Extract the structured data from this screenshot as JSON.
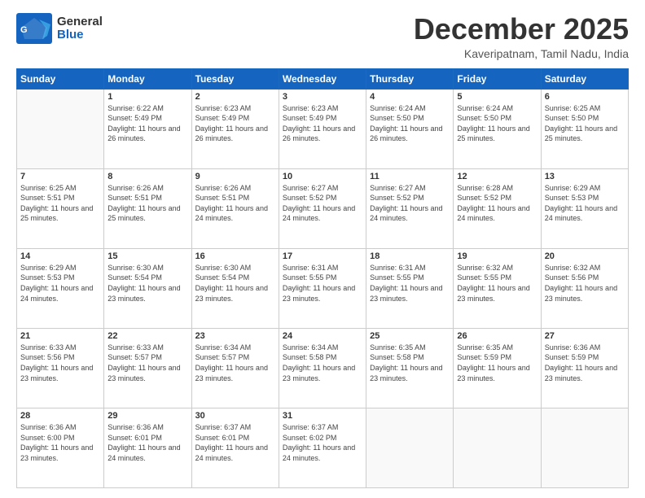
{
  "header": {
    "logo_general": "General",
    "logo_blue": "Blue",
    "month_title": "December 2025",
    "location": "Kaveripatnam, Tamil Nadu, India"
  },
  "days_of_week": [
    "Sunday",
    "Monday",
    "Tuesday",
    "Wednesday",
    "Thursday",
    "Friday",
    "Saturday"
  ],
  "weeks": [
    {
      "days": [
        {
          "num": "",
          "empty": true
        },
        {
          "num": "1",
          "sunrise": "6:22 AM",
          "sunset": "5:49 PM",
          "daylight": "11 hours and 26 minutes."
        },
        {
          "num": "2",
          "sunrise": "6:23 AM",
          "sunset": "5:49 PM",
          "daylight": "11 hours and 26 minutes."
        },
        {
          "num": "3",
          "sunrise": "6:23 AM",
          "sunset": "5:49 PM",
          "daylight": "11 hours and 26 minutes."
        },
        {
          "num": "4",
          "sunrise": "6:24 AM",
          "sunset": "5:50 PM",
          "daylight": "11 hours and 26 minutes."
        },
        {
          "num": "5",
          "sunrise": "6:24 AM",
          "sunset": "5:50 PM",
          "daylight": "11 hours and 25 minutes."
        },
        {
          "num": "6",
          "sunrise": "6:25 AM",
          "sunset": "5:50 PM",
          "daylight": "11 hours and 25 minutes."
        }
      ]
    },
    {
      "days": [
        {
          "num": "7",
          "sunrise": "6:25 AM",
          "sunset": "5:51 PM",
          "daylight": "11 hours and 25 minutes."
        },
        {
          "num": "8",
          "sunrise": "6:26 AM",
          "sunset": "5:51 PM",
          "daylight": "11 hours and 25 minutes."
        },
        {
          "num": "9",
          "sunrise": "6:26 AM",
          "sunset": "5:51 PM",
          "daylight": "11 hours and 24 minutes."
        },
        {
          "num": "10",
          "sunrise": "6:27 AM",
          "sunset": "5:52 PM",
          "daylight": "11 hours and 24 minutes."
        },
        {
          "num": "11",
          "sunrise": "6:27 AM",
          "sunset": "5:52 PM",
          "daylight": "11 hours and 24 minutes."
        },
        {
          "num": "12",
          "sunrise": "6:28 AM",
          "sunset": "5:52 PM",
          "daylight": "11 hours and 24 minutes."
        },
        {
          "num": "13",
          "sunrise": "6:29 AM",
          "sunset": "5:53 PM",
          "daylight": "11 hours and 24 minutes."
        }
      ]
    },
    {
      "days": [
        {
          "num": "14",
          "sunrise": "6:29 AM",
          "sunset": "5:53 PM",
          "daylight": "11 hours and 24 minutes."
        },
        {
          "num": "15",
          "sunrise": "6:30 AM",
          "sunset": "5:54 PM",
          "daylight": "11 hours and 23 minutes."
        },
        {
          "num": "16",
          "sunrise": "6:30 AM",
          "sunset": "5:54 PM",
          "daylight": "11 hours and 23 minutes."
        },
        {
          "num": "17",
          "sunrise": "6:31 AM",
          "sunset": "5:55 PM",
          "daylight": "11 hours and 23 minutes."
        },
        {
          "num": "18",
          "sunrise": "6:31 AM",
          "sunset": "5:55 PM",
          "daylight": "11 hours and 23 minutes."
        },
        {
          "num": "19",
          "sunrise": "6:32 AM",
          "sunset": "5:55 PM",
          "daylight": "11 hours and 23 minutes."
        },
        {
          "num": "20",
          "sunrise": "6:32 AM",
          "sunset": "5:56 PM",
          "daylight": "11 hours and 23 minutes."
        }
      ]
    },
    {
      "days": [
        {
          "num": "21",
          "sunrise": "6:33 AM",
          "sunset": "5:56 PM",
          "daylight": "11 hours and 23 minutes."
        },
        {
          "num": "22",
          "sunrise": "6:33 AM",
          "sunset": "5:57 PM",
          "daylight": "11 hours and 23 minutes."
        },
        {
          "num": "23",
          "sunrise": "6:34 AM",
          "sunset": "5:57 PM",
          "daylight": "11 hours and 23 minutes."
        },
        {
          "num": "24",
          "sunrise": "6:34 AM",
          "sunset": "5:58 PM",
          "daylight": "11 hours and 23 minutes."
        },
        {
          "num": "25",
          "sunrise": "6:35 AM",
          "sunset": "5:58 PM",
          "daylight": "11 hours and 23 minutes."
        },
        {
          "num": "26",
          "sunrise": "6:35 AM",
          "sunset": "5:59 PM",
          "daylight": "11 hours and 23 minutes."
        },
        {
          "num": "27",
          "sunrise": "6:36 AM",
          "sunset": "5:59 PM",
          "daylight": "11 hours and 23 minutes."
        }
      ]
    },
    {
      "days": [
        {
          "num": "28",
          "sunrise": "6:36 AM",
          "sunset": "6:00 PM",
          "daylight": "11 hours and 23 minutes."
        },
        {
          "num": "29",
          "sunrise": "6:36 AM",
          "sunset": "6:01 PM",
          "daylight": "11 hours and 24 minutes."
        },
        {
          "num": "30",
          "sunrise": "6:37 AM",
          "sunset": "6:01 PM",
          "daylight": "11 hours and 24 minutes."
        },
        {
          "num": "31",
          "sunrise": "6:37 AM",
          "sunset": "6:02 PM",
          "daylight": "11 hours and 24 minutes."
        },
        {
          "num": "",
          "empty": true
        },
        {
          "num": "",
          "empty": true
        },
        {
          "num": "",
          "empty": true
        }
      ]
    }
  ]
}
